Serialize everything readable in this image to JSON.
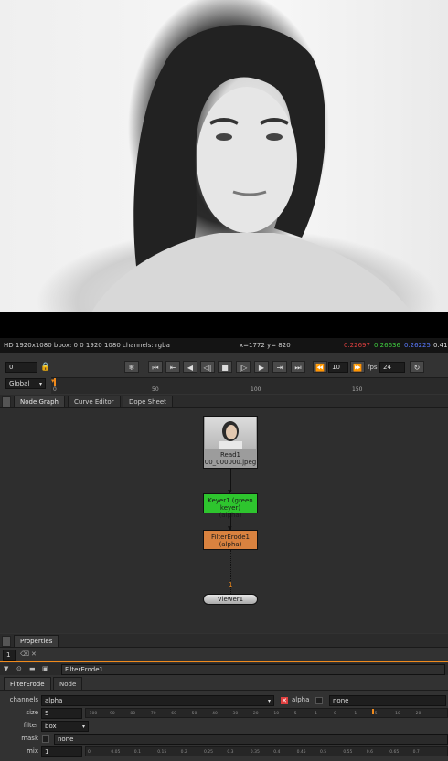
{
  "viewer": {
    "info_left": "HD 1920x1080 bbox: 0 0 1920 1080 channels: rgba",
    "coords": "x=1772 y= 820",
    "r": "0.22697",
    "g": "0.26636",
    "b": "0.26225",
    "a": "0.41"
  },
  "timeline": {
    "frame": "0",
    "range_mode": "Global",
    "skip": "10",
    "fps_label": "fps",
    "fps": "24",
    "ticks": [
      "0",
      "50",
      "100",
      "150"
    ],
    "buttons": [
      "❄",
      "⏮",
      "⇤",
      "◀",
      "◁|",
      "■",
      "|▷",
      "▶",
      "⇥",
      "⏭",
      "⏪",
      "⏩",
      "↻"
    ]
  },
  "graph_tabs": [
    "Node Graph",
    "Curve Editor",
    "Dope Sheet"
  ],
  "nodes": {
    "read": {
      "title": "Read1",
      "file": "00_000000.jpeg"
    },
    "keyer": {
      "title": "Keyer1 (green keyer)",
      "sub": "(alpha)"
    },
    "erode": {
      "title": "FilterErode1",
      "sub": "(alpha)"
    },
    "pipe_label": "1",
    "viewer": "Viewer1"
  },
  "properties": {
    "tab": "Properties",
    "max_panels": "1",
    "node_name": "FilterErode1",
    "subtabs": [
      "FilterErode",
      "Node"
    ],
    "channels_label": "channels",
    "channels_value": "alpha",
    "alpha_label": "alpha",
    "none_value": "none",
    "size_label": "size",
    "size_value": "5",
    "size_ticks": [
      "-100",
      "-90",
      "-80",
      "-70",
      "-60",
      "-50",
      "-40",
      "-30",
      "-20",
      "-10",
      "-5",
      "-1",
      "0",
      "1",
      "5",
      "10",
      "20"
    ],
    "filter_label": "filter",
    "filter_value": "box",
    "mask_label": "mask",
    "mask_value": "none",
    "mix_label": "mix",
    "mix_value": "1",
    "mix_ticks": [
      "0",
      "0.05",
      "0.1",
      "0.15",
      "0.2",
      "0.25",
      "0.3",
      "0.35",
      "0.4",
      "0.45",
      "0.5",
      "0.55",
      "0.6",
      "0.65",
      "0.7"
    ]
  },
  "colors": {
    "keyer": "#2ec52e",
    "erode": "#d9823f",
    "accent": "#f08a1c",
    "red": "#e04040",
    "green": "#40d040",
    "blue": "#4060ff"
  }
}
